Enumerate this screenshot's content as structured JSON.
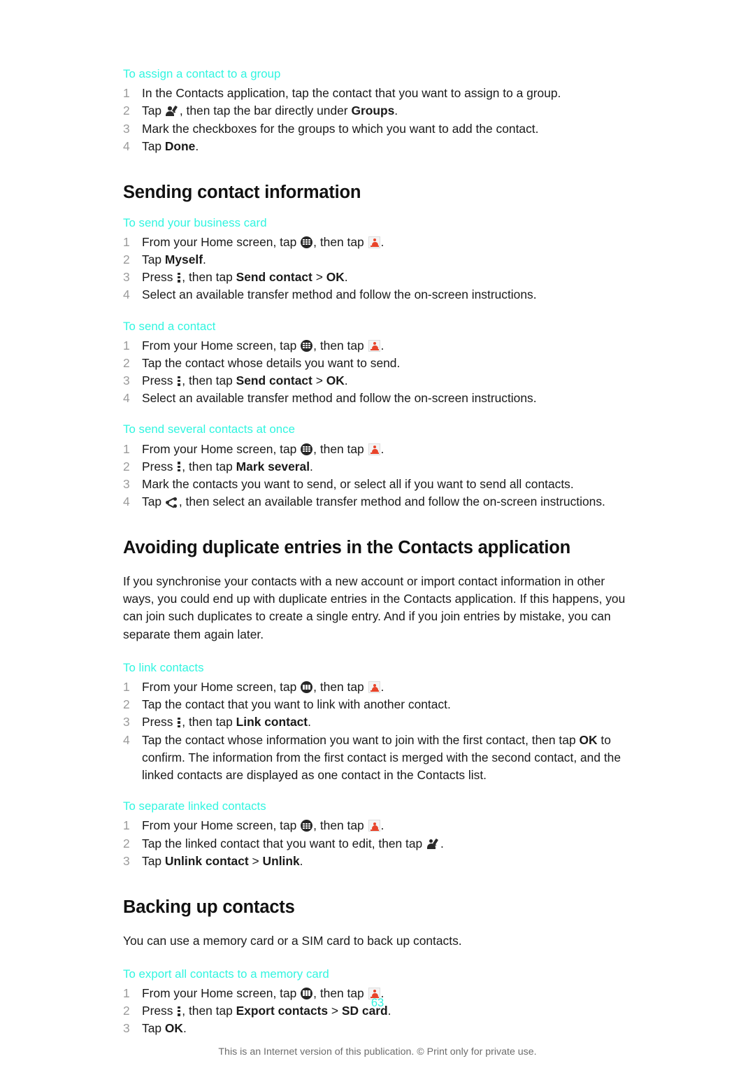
{
  "document": {
    "page_number": "63",
    "footer_note": "This is an Internet version of this publication. © Print only for private use.",
    "accent_color": "#31f5e0",
    "text_color": "#1a1a1a",
    "number_color": "#9b9b9b"
  },
  "icons": {
    "app_drawer": "app-drawer-icon",
    "contacts": "contacts-icon",
    "menu_key": "overflow-menu-icon",
    "edit_contact": "edit-contact-icon",
    "share": "share-icon"
  },
  "sections": [
    {
      "id": "assign-contact-group",
      "subheading": "To assign a contact to a group",
      "steps": [
        {
          "parts": [
            {
              "t": "text",
              "v": "In the Contacts application, tap the contact that you want to assign to a group."
            }
          ]
        },
        {
          "parts": [
            {
              "t": "text",
              "v": "Tap "
            },
            {
              "t": "icon",
              "v": "edit_contact"
            },
            {
              "t": "text",
              "v": ", then tap the bar directly under "
            },
            {
              "t": "bold",
              "v": "Groups"
            },
            {
              "t": "text",
              "v": "."
            }
          ]
        },
        {
          "parts": [
            {
              "t": "text",
              "v": "Mark the checkboxes for the groups to which you want to add the contact."
            }
          ]
        },
        {
          "parts": [
            {
              "t": "text",
              "v": "Tap "
            },
            {
              "t": "bold",
              "v": "Done"
            },
            {
              "t": "text",
              "v": "."
            }
          ]
        }
      ]
    },
    {
      "id": "sending-contact-information",
      "heading": "Sending contact information",
      "subheading": "To send your business card",
      "steps": [
        {
          "parts": [
            {
              "t": "text",
              "v": "From your Home screen, tap "
            },
            {
              "t": "icon",
              "v": "app_drawer"
            },
            {
              "t": "text",
              "v": ", then tap "
            },
            {
              "t": "icon",
              "v": "contacts"
            },
            {
              "t": "text",
              "v": "."
            }
          ]
        },
        {
          "parts": [
            {
              "t": "text",
              "v": "Tap "
            },
            {
              "t": "bold",
              "v": "Myself"
            },
            {
              "t": "text",
              "v": "."
            }
          ]
        },
        {
          "parts": [
            {
              "t": "text",
              "v": "Press "
            },
            {
              "t": "icon",
              "v": "menu_key"
            },
            {
              "t": "text",
              "v": ", then tap "
            },
            {
              "t": "bold",
              "v": "Send contact"
            },
            {
              "t": "text",
              "v": " > "
            },
            {
              "t": "bold",
              "v": "OK"
            },
            {
              "t": "text",
              "v": "."
            }
          ]
        },
        {
          "parts": [
            {
              "t": "text",
              "v": "Select an available transfer method and follow the on-screen instructions."
            }
          ]
        }
      ]
    },
    {
      "id": "send-a-contact",
      "subheading": "To send a contact",
      "steps": [
        {
          "parts": [
            {
              "t": "text",
              "v": "From your Home screen, tap "
            },
            {
              "t": "icon",
              "v": "app_drawer"
            },
            {
              "t": "text",
              "v": ", then tap "
            },
            {
              "t": "icon",
              "v": "contacts"
            },
            {
              "t": "text",
              "v": "."
            }
          ]
        },
        {
          "parts": [
            {
              "t": "text",
              "v": "Tap the contact whose details you want to send."
            }
          ]
        },
        {
          "parts": [
            {
              "t": "text",
              "v": "Press "
            },
            {
              "t": "icon",
              "v": "menu_key"
            },
            {
              "t": "text",
              "v": ", then tap "
            },
            {
              "t": "bold",
              "v": "Send contact"
            },
            {
              "t": "text",
              "v": " > "
            },
            {
              "t": "bold",
              "v": "OK"
            },
            {
              "t": "text",
              "v": "."
            }
          ]
        },
        {
          "parts": [
            {
              "t": "text",
              "v": "Select an available transfer method and follow the on-screen instructions."
            }
          ]
        }
      ]
    },
    {
      "id": "send-several-contacts",
      "subheading": "To send several contacts at once",
      "steps": [
        {
          "parts": [
            {
              "t": "text",
              "v": "From your Home screen, tap "
            },
            {
              "t": "icon",
              "v": "app_drawer"
            },
            {
              "t": "text",
              "v": ", then tap "
            },
            {
              "t": "icon",
              "v": "contacts"
            },
            {
              "t": "text",
              "v": "."
            }
          ]
        },
        {
          "parts": [
            {
              "t": "text",
              "v": "Press "
            },
            {
              "t": "icon",
              "v": "menu_key"
            },
            {
              "t": "text",
              "v": ", then tap "
            },
            {
              "t": "bold",
              "v": "Mark several"
            },
            {
              "t": "text",
              "v": "."
            }
          ]
        },
        {
          "parts": [
            {
              "t": "text",
              "v": "Mark the contacts you want to send, or select all if you want to send all contacts."
            }
          ]
        },
        {
          "parts": [
            {
              "t": "text",
              "v": "Tap "
            },
            {
              "t": "icon",
              "v": "share"
            },
            {
              "t": "text",
              "v": ", then select an available transfer method and follow the on-screen instructions."
            }
          ]
        }
      ]
    },
    {
      "id": "avoiding-duplicates",
      "heading": "Avoiding duplicate entries in the Contacts application",
      "paragraph": "If you synchronise your contacts with a new account or import contact information in other ways, you could end up with duplicate entries in the Contacts application. If this happens, you can join such duplicates to create a single entry. And if you join entries by mistake, you can separate them again later.",
      "subheading": "To link contacts",
      "steps": [
        {
          "parts": [
            {
              "t": "text",
              "v": "From your Home screen, tap "
            },
            {
              "t": "icon",
              "v": "app_drawer"
            },
            {
              "t": "text",
              "v": ", then tap "
            },
            {
              "t": "icon",
              "v": "contacts"
            },
            {
              "t": "text",
              "v": "."
            }
          ]
        },
        {
          "parts": [
            {
              "t": "text",
              "v": "Tap the contact that you want to link with another contact."
            }
          ]
        },
        {
          "parts": [
            {
              "t": "text",
              "v": "Press "
            },
            {
              "t": "icon",
              "v": "menu_key"
            },
            {
              "t": "text",
              "v": ", then tap "
            },
            {
              "t": "bold",
              "v": "Link contact"
            },
            {
              "t": "text",
              "v": "."
            }
          ]
        },
        {
          "parts": [
            {
              "t": "text",
              "v": "Tap the contact whose information you want to join with the first contact, then tap "
            },
            {
              "t": "bold",
              "v": "OK"
            },
            {
              "t": "text",
              "v": " to confirm. The information from the first contact is merged with the second contact, and the linked contacts are displayed as one contact in the Contacts list."
            }
          ]
        }
      ]
    },
    {
      "id": "separate-linked-contacts",
      "subheading": "To separate linked contacts",
      "steps": [
        {
          "parts": [
            {
              "t": "text",
              "v": "From your Home screen, tap "
            },
            {
              "t": "icon",
              "v": "app_drawer"
            },
            {
              "t": "text",
              "v": ", then tap "
            },
            {
              "t": "icon",
              "v": "contacts"
            },
            {
              "t": "text",
              "v": "."
            }
          ]
        },
        {
          "parts": [
            {
              "t": "text",
              "v": "Tap the linked contact that you want to edit, then tap "
            },
            {
              "t": "icon",
              "v": "edit_contact"
            },
            {
              "t": "text",
              "v": "."
            }
          ]
        },
        {
          "parts": [
            {
              "t": "text",
              "v": "Tap "
            },
            {
              "t": "bold",
              "v": "Unlink contact"
            },
            {
              "t": "text",
              "v": " > "
            },
            {
              "t": "bold",
              "v": "Unlink"
            },
            {
              "t": "text",
              "v": "."
            }
          ]
        }
      ]
    },
    {
      "id": "backing-up-contacts",
      "heading": "Backing up contacts",
      "paragraph": "You can use a memory card or a SIM card to back up contacts.",
      "subheading": "To export all contacts to a memory card",
      "steps": [
        {
          "parts": [
            {
              "t": "text",
              "v": "From your Home screen, tap "
            },
            {
              "t": "icon",
              "v": "app_drawer"
            },
            {
              "t": "text",
              "v": ", then tap "
            },
            {
              "t": "icon",
              "v": "contacts"
            },
            {
              "t": "text",
              "v": "."
            }
          ]
        },
        {
          "parts": [
            {
              "t": "text",
              "v": "Press "
            },
            {
              "t": "icon",
              "v": "menu_key"
            },
            {
              "t": "text",
              "v": ", then tap "
            },
            {
              "t": "bold",
              "v": "Export contacts"
            },
            {
              "t": "text",
              "v": " > "
            },
            {
              "t": "bold",
              "v": "SD card"
            },
            {
              "t": "text",
              "v": "."
            }
          ]
        },
        {
          "parts": [
            {
              "t": "text",
              "v": "Tap "
            },
            {
              "t": "bold",
              "v": "OK"
            },
            {
              "t": "text",
              "v": "."
            }
          ]
        }
      ]
    }
  ]
}
